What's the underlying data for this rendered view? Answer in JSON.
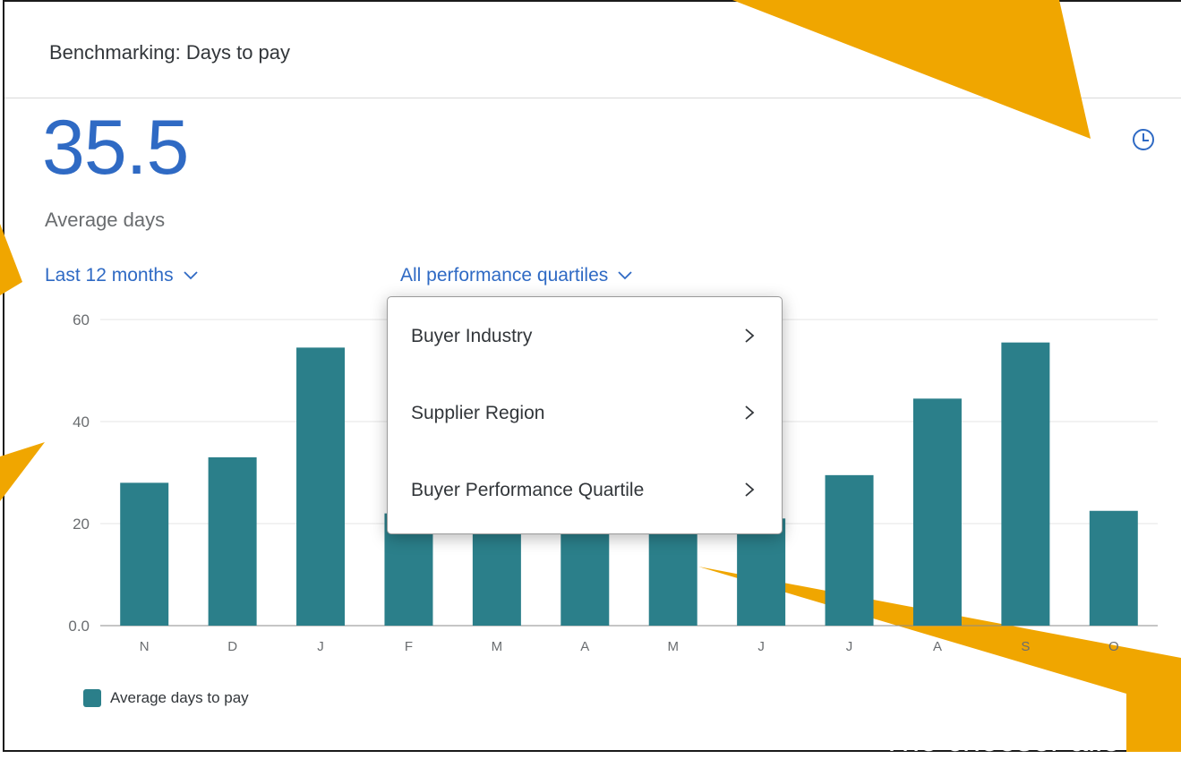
{
  "card": {
    "title": "Benchmarking: Days to pay",
    "kpi_value": "35.5",
    "kpi_label": "Average days"
  },
  "selectors": {
    "period": "Last 12 months",
    "quartile": "All performance quartiles"
  },
  "menu": {
    "items": [
      "Buyer Industry",
      "Supplier Region",
      "Buyer Performance Quartile"
    ]
  },
  "legend": {
    "label": "Average days to pay"
  },
  "callout": {
    "text": "The chooser allo"
  },
  "colors": {
    "bar": "#2b7f8a",
    "accent": "#2f6ac4",
    "callout": "#f0a600"
  },
  "chart_data": {
    "type": "bar",
    "categories": [
      "N",
      "D",
      "J",
      "F",
      "M",
      "A",
      "M",
      "J",
      "J",
      "A",
      "S",
      "O"
    ],
    "series": [
      {
        "name": "Average days to pay",
        "values": [
          28,
          33,
          54.5,
          22,
          21,
          21,
          21,
          21,
          29.5,
          44.5,
          55.5,
          22.5
        ]
      }
    ],
    "yticks": [
      "0.0",
      "20",
      "40",
      "60"
    ],
    "ylim": [
      0,
      60
    ],
    "grid": true,
    "legend": "bottom-left"
  }
}
